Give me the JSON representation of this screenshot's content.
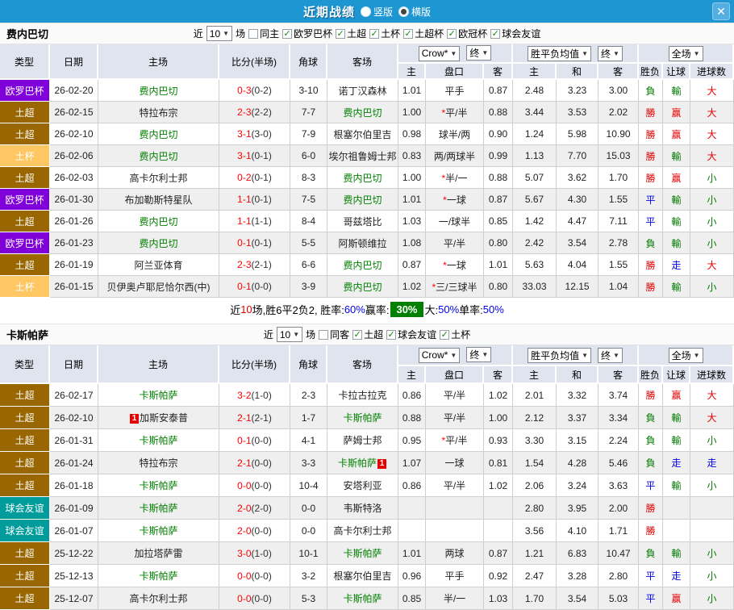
{
  "titlebar": {
    "title": "近期战绩",
    "radios": [
      {
        "label": "竖版",
        "selected": false
      },
      {
        "label": "横版",
        "selected": true
      }
    ],
    "close": "✕"
  },
  "colors": {
    "titlebar_bg": "#1E96D2",
    "header_bg": "#E0E4EE",
    "focus_team": "#008000",
    "score_red": "#FF0000",
    "summary_rate_box": "#008000",
    "type_colors": {
      "欧罗巴杯": "#7F00D8",
      "土超": "#9A6600",
      "土杯": "#FFC763",
      "球会友谊": "#009C9C"
    },
    "mark_colors": {
      "勝": "#E60000",
      "負": "#007B00",
      "平": "#0000E6",
      "赢": "#E60000",
      "輸": "#007B00",
      "走": "#0000E6",
      "大": "#E60000",
      "小": "#007B00"
    }
  },
  "tables": [
    {
      "team": "费内巴切",
      "filter": {
        "near": "近",
        "count": "10",
        "games": "场",
        "same_label": "同主",
        "same_checked": false,
        "leagues": [
          {
            "label": "欧罗巴杯",
            "checked": true
          },
          {
            "label": "土超",
            "checked": true
          },
          {
            "label": "土杯",
            "checked": true
          },
          {
            "label": "土超杯",
            "checked": true
          },
          {
            "label": "欧冠杯",
            "checked": true
          },
          {
            "label": "球会友谊",
            "checked": true
          }
        ]
      },
      "selects": {
        "company": "Crow*",
        "final_a": "终",
        "avg": "胜平负均值",
        "final_b": "终",
        "scope": "全场"
      },
      "headers": {
        "type": "类型",
        "date": "日期",
        "home": "主场",
        "score": "比分(半场)",
        "corners": "角球",
        "away": "客场",
        "h": "主",
        "handicap": "盘口",
        "a": "客",
        "w": "主",
        "d": "和",
        "l": "客",
        "result": "胜负",
        "cover": "让球",
        "goals": "进球数"
      },
      "rows": [
        {
          "type": "欧罗巴杯",
          "date": "26-02-20",
          "home": "费内巴切",
          "home_focus": true,
          "home_rc": null,
          "score": "0-3",
          "half": "(0-2)",
          "corners": "3-10",
          "away": "诺丁汉森林",
          "away_focus": false,
          "away_rc": null,
          "h": "1.01",
          "star": false,
          "handicap": "平手",
          "a": "0.87",
          "w": "2.48",
          "d": "3.23",
          "l": "3.00",
          "result": "負",
          "cover": "輸",
          "goals": "大"
        },
        {
          "type": "土超",
          "date": "26-02-15",
          "home": "特拉布宗",
          "home_focus": false,
          "home_rc": null,
          "score": "2-3",
          "half": "(2-2)",
          "corners": "7-7",
          "away": "费内巴切",
          "away_focus": true,
          "away_rc": null,
          "h": "1.00",
          "star": true,
          "handicap": "平/半",
          "a": "0.88",
          "w": "3.44",
          "d": "3.53",
          "l": "2.02",
          "result": "勝",
          "cover": "赢",
          "goals": "大"
        },
        {
          "type": "土超",
          "date": "26-02-10",
          "home": "费内巴切",
          "home_focus": true,
          "home_rc": null,
          "score": "3-1",
          "half": "(3-0)",
          "corners": "7-9",
          "away": "根塞尔伯里吉",
          "away_focus": false,
          "away_rc": null,
          "h": "0.98",
          "star": false,
          "handicap": "球半/两",
          "a": "0.90",
          "w": "1.24",
          "d": "5.98",
          "l": "10.90",
          "result": "勝",
          "cover": "赢",
          "goals": "大"
        },
        {
          "type": "土杯",
          "date": "26-02-06",
          "home": "费内巴切",
          "home_focus": true,
          "home_rc": null,
          "score": "3-1",
          "half": "(0-1)",
          "corners": "6-0",
          "away": "埃尔祖鲁姆士邦",
          "away_focus": false,
          "away_rc": null,
          "h": "0.83",
          "star": false,
          "handicap": "两/两球半",
          "a": "0.99",
          "w": "1.13",
          "d": "7.70",
          "l": "15.03",
          "result": "勝",
          "cover": "輸",
          "goals": "大"
        },
        {
          "type": "土超",
          "date": "26-02-03",
          "home": "高卡尔利士邦",
          "home_focus": false,
          "home_rc": null,
          "score": "0-2",
          "half": "(0-1)",
          "corners": "8-3",
          "away": "费内巴切",
          "away_focus": true,
          "away_rc": null,
          "h": "1.00",
          "star": true,
          "handicap": "半/一",
          "a": "0.88",
          "w": "5.07",
          "d": "3.62",
          "l": "1.70",
          "result": "勝",
          "cover": "赢",
          "goals": "小"
        },
        {
          "type": "欧罗巴杯",
          "date": "26-01-30",
          "home": "布加勒斯特星队",
          "home_focus": false,
          "home_rc": null,
          "score": "1-1",
          "half": "(0-1)",
          "corners": "7-5",
          "away": "费内巴切",
          "away_focus": true,
          "away_rc": null,
          "h": "1.01",
          "star": true,
          "handicap": "一球",
          "a": "0.87",
          "w": "5.67",
          "d": "4.30",
          "l": "1.55",
          "result": "平",
          "cover": "輸",
          "goals": "小"
        },
        {
          "type": "土超",
          "date": "26-01-26",
          "home": "费内巴切",
          "home_focus": true,
          "home_rc": null,
          "score": "1-1",
          "half": "(1-1)",
          "corners": "8-4",
          "away": "哥兹塔比",
          "away_focus": false,
          "away_rc": null,
          "h": "1.03",
          "star": false,
          "handicap": "一/球半",
          "a": "0.85",
          "w": "1.42",
          "d": "4.47",
          "l": "7.11",
          "result": "平",
          "cover": "輸",
          "goals": "小"
        },
        {
          "type": "欧罗巴杯",
          "date": "26-01-23",
          "home": "费内巴切",
          "home_focus": true,
          "home_rc": null,
          "score": "0-1",
          "half": "(0-1)",
          "corners": "5-5",
          "away": "阿斯顿维拉",
          "away_focus": false,
          "away_rc": null,
          "h": "1.08",
          "star": false,
          "handicap": "平/半",
          "a": "0.80",
          "w": "2.42",
          "d": "3.54",
          "l": "2.78",
          "result": "負",
          "cover": "輸",
          "goals": "小"
        },
        {
          "type": "土超",
          "date": "26-01-19",
          "home": "阿兰亚体育",
          "home_focus": false,
          "home_rc": null,
          "score": "2-3",
          "half": "(2-1)",
          "corners": "6-6",
          "away": "费内巴切",
          "away_focus": true,
          "away_rc": null,
          "h": "0.87",
          "star": true,
          "handicap": "一球",
          "a": "1.01",
          "w": "5.63",
          "d": "4.04",
          "l": "1.55",
          "result": "勝",
          "cover": "走",
          "goals": "大"
        },
        {
          "type": "土杯",
          "date": "26-01-15",
          "home": "贝伊奥卢耶尼恰尔西(中)",
          "home_focus": false,
          "home_rc": null,
          "score": "0-1",
          "half": "(0-0)",
          "corners": "3-9",
          "away": "费内巴切",
          "away_focus": true,
          "away_rc": null,
          "h": "1.02",
          "star": true,
          "handicap": "三/三球半",
          "a": "0.80",
          "w": "33.03",
          "d": "12.15",
          "l": "1.04",
          "result": "勝",
          "cover": "輸",
          "goals": "小"
        }
      ],
      "summary": [
        {
          "text": "近",
          "style": "plain"
        },
        {
          "text": "10",
          "style": "red"
        },
        {
          "text": "场,胜6平2负2, 胜率:",
          "style": "plain"
        },
        {
          "text": "60%",
          "style": "blue"
        },
        {
          "text": " 赢率: ",
          "style": "plain"
        },
        {
          "text": "30%",
          "style": "greenbox"
        },
        {
          "text": " 大:",
          "style": "plain"
        },
        {
          "text": "50%",
          "style": "blue"
        },
        {
          "text": " 单率:",
          "style": "plain"
        },
        {
          "text": "50%",
          "style": "blue"
        }
      ]
    },
    {
      "team": "卡斯帕萨",
      "filter": {
        "near": "近",
        "count": "10",
        "games": "场",
        "same_label": "同客",
        "same_checked": false,
        "leagues": [
          {
            "label": "土超",
            "checked": true
          },
          {
            "label": "球会友谊",
            "checked": true
          },
          {
            "label": "土杯",
            "checked": true
          }
        ]
      },
      "selects": {
        "company": "Crow*",
        "final_a": "终",
        "avg": "胜平负均值",
        "final_b": "终",
        "scope": "全场"
      },
      "headers": {
        "type": "类型",
        "date": "日期",
        "home": "主场",
        "score": "比分(半场)",
        "corners": "角球",
        "away": "客场",
        "h": "主",
        "handicap": "盘口",
        "a": "客",
        "w": "主",
        "d": "和",
        "l": "客",
        "result": "胜负",
        "cover": "让球",
        "goals": "进球数"
      },
      "rows": [
        {
          "type": "土超",
          "date": "26-02-17",
          "home": "卡斯帕萨",
          "home_focus": true,
          "home_rc": null,
          "score": "3-2",
          "half": "(1-0)",
          "corners": "2-3",
          "away": "卡拉古拉克",
          "away_focus": false,
          "away_rc": null,
          "h": "0.86",
          "star": false,
          "handicap": "平/半",
          "a": "1.02",
          "w": "2.01",
          "d": "3.32",
          "l": "3.74",
          "result": "勝",
          "cover": "赢",
          "goals": "大"
        },
        {
          "type": "土超",
          "date": "26-02-10",
          "home": "加斯安泰普",
          "home_focus": false,
          "home_rc": "before",
          "score": "2-1",
          "half": "(2-1)",
          "corners": "1-7",
          "away": "卡斯帕萨",
          "away_focus": true,
          "away_rc": null,
          "h": "0.88",
          "star": false,
          "handicap": "平/半",
          "a": "1.00",
          "w": "2.12",
          "d": "3.37",
          "l": "3.34",
          "result": "負",
          "cover": "輸",
          "goals": "大"
        },
        {
          "type": "土超",
          "date": "26-01-31",
          "home": "卡斯帕萨",
          "home_focus": true,
          "home_rc": null,
          "score": "0-1",
          "half": "(0-0)",
          "corners": "4-1",
          "away": "萨姆士邦",
          "away_focus": false,
          "away_rc": null,
          "h": "0.95",
          "star": true,
          "handicap": "平/半",
          "a": "0.93",
          "w": "3.30",
          "d": "3.15",
          "l": "2.24",
          "result": "負",
          "cover": "輸",
          "goals": "小"
        },
        {
          "type": "土超",
          "date": "26-01-24",
          "home": "特拉布宗",
          "home_focus": false,
          "home_rc": null,
          "score": "2-1",
          "half": "(0-0)",
          "corners": "3-3",
          "away": "卡斯帕萨",
          "away_focus": true,
          "away_rc": "after",
          "h": "1.07",
          "star": false,
          "handicap": "一球",
          "a": "0.81",
          "w": "1.54",
          "d": "4.28",
          "l": "5.46",
          "result": "負",
          "cover": "走",
          "goals": "走"
        },
        {
          "type": "土超",
          "date": "26-01-18",
          "home": "卡斯帕萨",
          "home_focus": true,
          "home_rc": null,
          "score": "0-0",
          "half": "(0-0)",
          "corners": "10-4",
          "away": "安塔利亚",
          "away_focus": false,
          "away_rc": null,
          "h": "0.86",
          "star": false,
          "handicap": "平/半",
          "a": "1.02",
          "w": "2.06",
          "d": "3.24",
          "l": "3.63",
          "result": "平",
          "cover": "輸",
          "goals": "小"
        },
        {
          "type": "球会友谊",
          "date": "26-01-09",
          "home": "卡斯帕萨",
          "home_focus": true,
          "home_rc": null,
          "score": "2-0",
          "half": "(2-0)",
          "corners": "0-0",
          "away": "韦斯特洛",
          "away_focus": false,
          "away_rc": null,
          "h": "",
          "star": false,
          "handicap": "",
          "a": "",
          "w": "2.80",
          "d": "3.95",
          "l": "2.00",
          "result": "勝",
          "cover": "",
          "goals": ""
        },
        {
          "type": "球会友谊",
          "date": "26-01-07",
          "home": "卡斯帕萨",
          "home_focus": true,
          "home_rc": null,
          "score": "2-0",
          "half": "(0-0)",
          "corners": "0-0",
          "away": "高卡尔利士邦",
          "away_focus": false,
          "away_rc": null,
          "h": "",
          "star": false,
          "handicap": "",
          "a": "",
          "w": "3.56",
          "d": "4.10",
          "l": "1.71",
          "result": "勝",
          "cover": "",
          "goals": ""
        },
        {
          "type": "土超",
          "date": "25-12-22",
          "home": "加拉塔萨雷",
          "home_focus": false,
          "home_rc": null,
          "score": "3-0",
          "half": "(1-0)",
          "corners": "10-1",
          "away": "卡斯帕萨",
          "away_focus": true,
          "away_rc": null,
          "h": "1.01",
          "star": false,
          "handicap": "两球",
          "a": "0.87",
          "w": "1.21",
          "d": "6.83",
          "l": "10.47",
          "result": "負",
          "cover": "輸",
          "goals": "小"
        },
        {
          "type": "土超",
          "date": "25-12-13",
          "home": "卡斯帕萨",
          "home_focus": true,
          "home_rc": null,
          "score": "0-0",
          "half": "(0-0)",
          "corners": "3-2",
          "away": "根塞尔伯里吉",
          "away_focus": false,
          "away_rc": null,
          "h": "0.96",
          "star": false,
          "handicap": "平手",
          "a": "0.92",
          "w": "2.47",
          "d": "3.28",
          "l": "2.80",
          "result": "平",
          "cover": "走",
          "goals": "小"
        },
        {
          "type": "土超",
          "date": "25-12-07",
          "home": "高卡尔利士邦",
          "home_focus": false,
          "home_rc": null,
          "score": "0-0",
          "half": "(0-0)",
          "corners": "5-3",
          "away": "卡斯帕萨",
          "away_focus": true,
          "away_rc": null,
          "h": "0.85",
          "star": false,
          "handicap": "半/一",
          "a": "1.03",
          "w": "1.70",
          "d": "3.54",
          "l": "5.03",
          "result": "平",
          "cover": "赢",
          "goals": "小"
        }
      ],
      "summary": null
    }
  ]
}
